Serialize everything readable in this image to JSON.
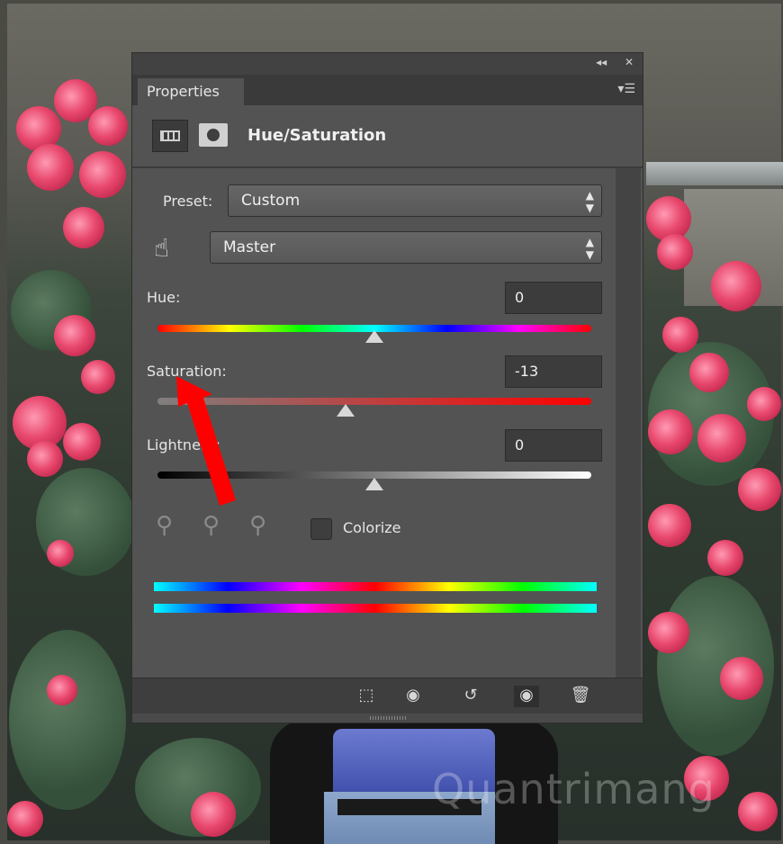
{
  "panel": {
    "tab_label": "Properties",
    "title": "Hue/Saturation",
    "topbar_icons": [
      "collapse-icon",
      "close-icon"
    ],
    "preset": {
      "label": "Preset:",
      "value": "Custom"
    },
    "channel": {
      "value": "Master"
    },
    "hue": {
      "label": "Hue:",
      "value": "0"
    },
    "saturation": {
      "label": "Saturation:",
      "value": "-13"
    },
    "lightness": {
      "label": "Lightness:",
      "value": "0"
    },
    "colorize": {
      "label": "Colorize",
      "checked": false
    },
    "bottom_icons": [
      "clip-to-layer-icon",
      "view-previous-icon",
      "reset-icon",
      "visibility-eye-icon",
      "delete-trash-icon"
    ]
  },
  "watermark": "Quantrimang",
  "annotation": {
    "color": "#ff0000",
    "points_to": "saturation-label"
  }
}
